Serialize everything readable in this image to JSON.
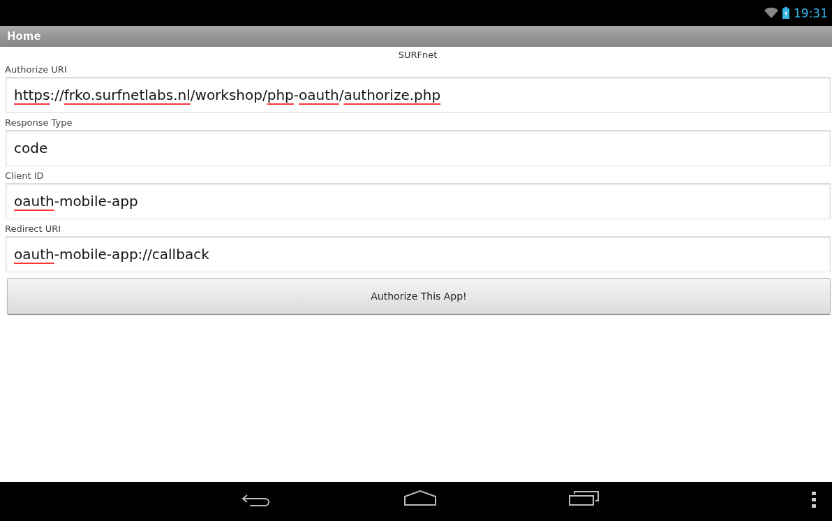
{
  "status_bar": {
    "time": "19:31"
  },
  "action_bar": {
    "title": "Home"
  },
  "heading": "SURFnet",
  "fields": [
    {
      "label": "Authorize URI",
      "value_parts": [
        {
          "text": "https",
          "misspelled": true
        },
        {
          "text": "://",
          "misspelled": false
        },
        {
          "text": "frko.surfnetlabs.nl",
          "misspelled": true
        },
        {
          "text": "/workshop/",
          "misspelled": false
        },
        {
          "text": "php",
          "misspelled": true
        },
        {
          "text": "-",
          "misspelled": false
        },
        {
          "text": "oauth",
          "misspelled": true
        },
        {
          "text": "/",
          "misspelled": false
        },
        {
          "text": "authorize.php",
          "misspelled": true
        }
      ]
    },
    {
      "label": "Response Type",
      "value_parts": [
        {
          "text": "code",
          "misspelled": false
        }
      ]
    },
    {
      "label": "Client ID",
      "value_parts": [
        {
          "text": "oauth",
          "misspelled": true
        },
        {
          "text": "-mobile-app",
          "misspelled": false
        }
      ]
    },
    {
      "label": "Redirect URI",
      "value_parts": [
        {
          "text": "oauth",
          "misspelled": true
        },
        {
          "text": "-mobile-app://callback",
          "misspelled": false
        }
      ]
    }
  ],
  "button": "Authorize This App!"
}
